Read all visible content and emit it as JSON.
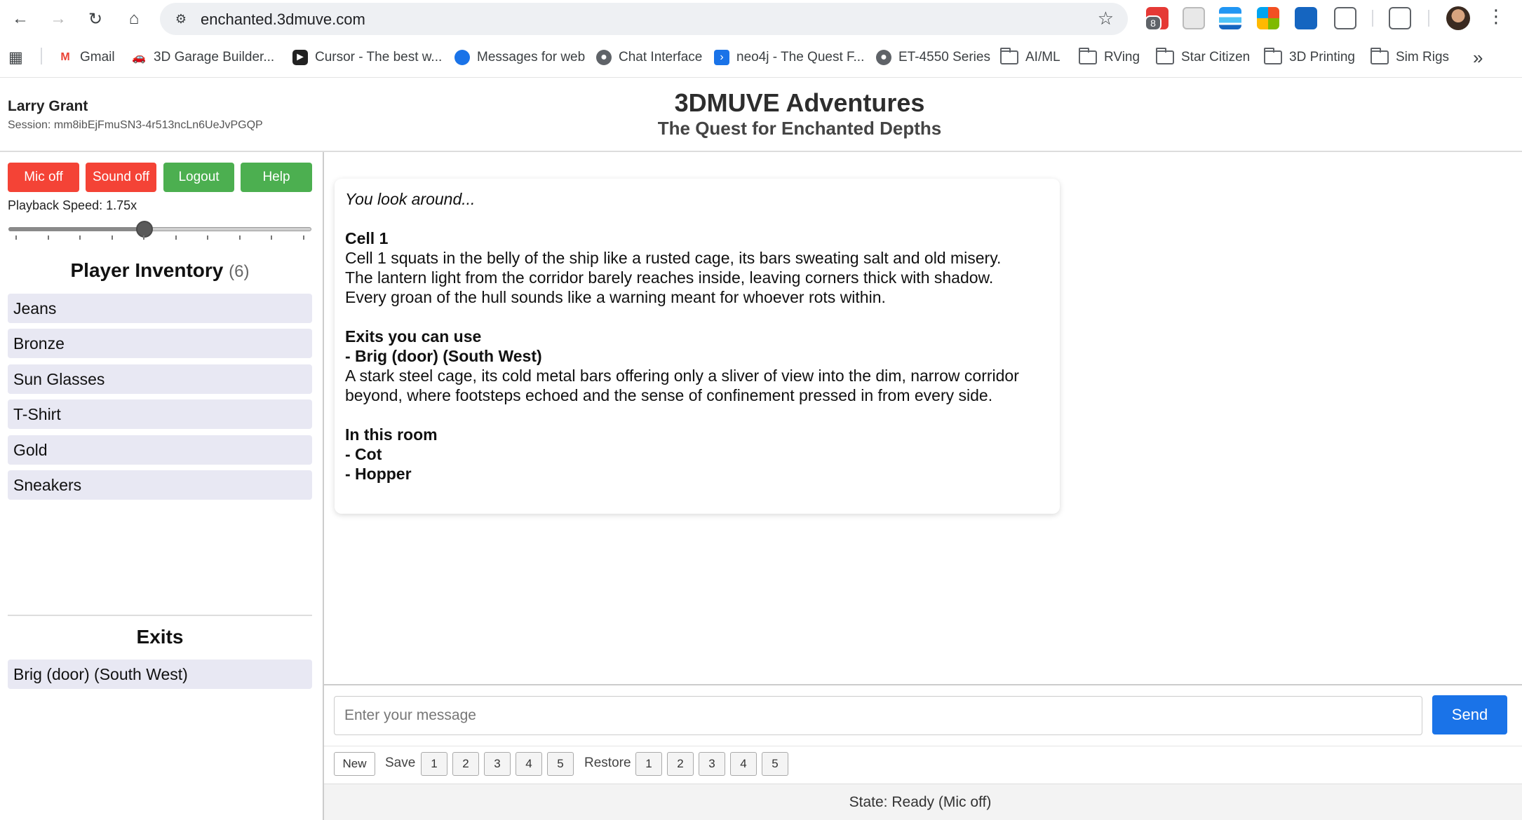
{
  "browser": {
    "url": "enchanted.3dmuve.com",
    "extension_badge": "8",
    "bookmarks": [
      {
        "label": "Gmail",
        "icon": "gmail-icon"
      },
      {
        "label": "3D Garage Builder...",
        "icon": "car-icon"
      },
      {
        "label": "Cursor - The best w...",
        "icon": "cursor-icon"
      },
      {
        "label": "Messages for web",
        "icon": "messages-icon"
      },
      {
        "label": "Chat Interface",
        "icon": "globe-icon"
      },
      {
        "label": "neo4j - The Quest F...",
        "icon": "terminal-icon"
      },
      {
        "label": "ET-4550 Series",
        "icon": "globe-icon"
      },
      {
        "label": "AI/ML",
        "icon": "folder-icon"
      },
      {
        "label": "RVing",
        "icon": "folder-icon"
      },
      {
        "label": "Star Citizen",
        "icon": "folder-icon"
      },
      {
        "label": "3D Printing",
        "icon": "folder-icon"
      },
      {
        "label": "Sim Rigs",
        "icon": "folder-icon"
      }
    ]
  },
  "header": {
    "user_name": "Larry Grant",
    "session": "Session: mm8ibEjFmuSN3-4r513ncLn6UeJvPGQP",
    "title": "3DMUVE Adventures",
    "subtitle": "The Quest for Enchanted Depths"
  },
  "controls": {
    "mic_label": "Mic off",
    "sound_label": "Sound off",
    "logout_label": "Logout",
    "help_label": "Help",
    "playback_label": "Playback Speed: 1.75x",
    "playback_fraction": 0.45,
    "colors": {
      "red": "#f44336",
      "green": "#4caf50",
      "send": "#1a73e8"
    }
  },
  "inventory": {
    "title": "Player Inventory",
    "count": "(6)",
    "items": [
      "Jeans",
      "Bronze",
      "Sun Glasses",
      "T-Shirt",
      "Gold",
      "Sneakers"
    ]
  },
  "exits": {
    "title": "Exits",
    "items": [
      "Brig (door) (South West)"
    ]
  },
  "story": {
    "intro": "You look around...",
    "room_name": "Cell 1",
    "room_desc_1": "Cell 1 squats in the belly of the ship like a rusted cage, its bars sweating salt and old misery.",
    "room_desc_2": "The lantern light from the corridor barely reaches inside, leaving corners thick with shadow.",
    "room_desc_3": "Every groan of the hull sounds like a warning meant for whoever rots within.",
    "exits_heading": "Exits you can use",
    "exit_1": "- Brig (door) (South West)",
    "exit_desc_1": "A stark steel cage, its cold metal bars offering only a sliver of view into the dim, narrow corridor",
    "exit_desc_2": "beyond, where footsteps echoed and the sense of confinement pressed in from every side.",
    "room_heading": "In this room",
    "room_item_1": "- Cot",
    "room_item_2": "- Hopper"
  },
  "input": {
    "placeholder": "Enter your message",
    "send_label": "Send"
  },
  "save_restore": {
    "new_label": "New",
    "save_label": "Save",
    "restore_label": "Restore",
    "slots": [
      "1",
      "2",
      "3",
      "4",
      "5"
    ]
  },
  "status": "State: Ready (Mic off)"
}
